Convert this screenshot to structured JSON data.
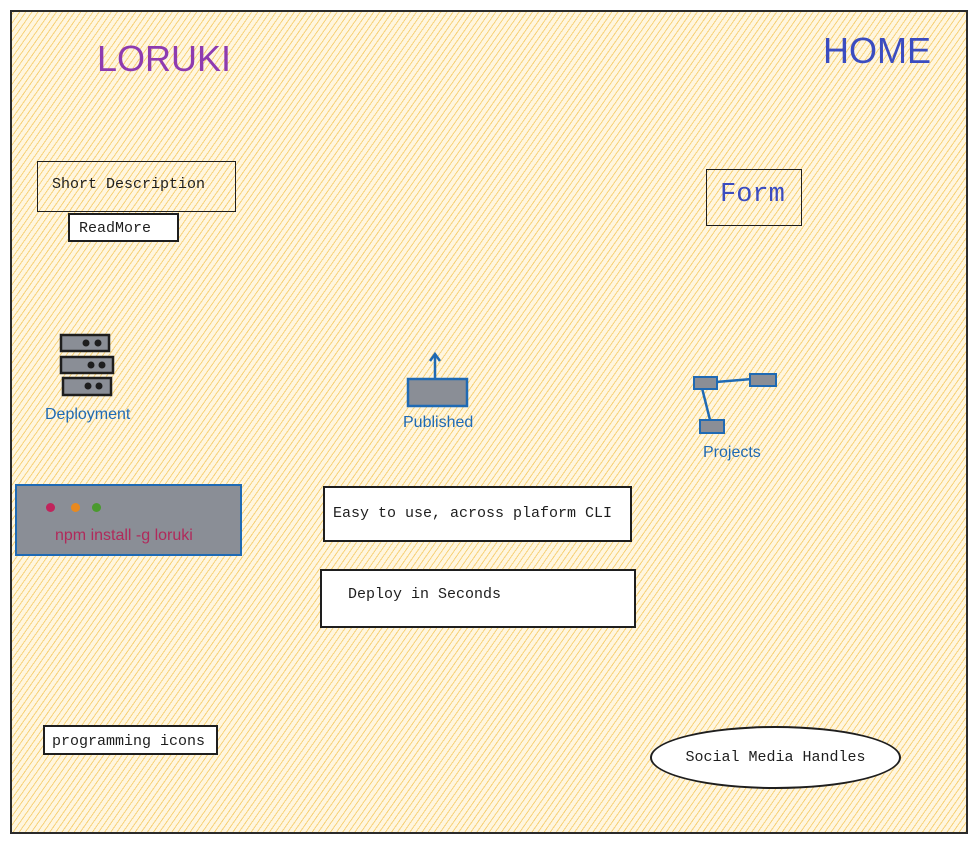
{
  "header": {
    "logo": "LORUKI",
    "nav_home": "HOME"
  },
  "hero": {
    "short_description": "Short Description",
    "readmore_label": "ReadMore",
    "form_label": "Form"
  },
  "features": [
    {
      "label": "Deployment",
      "icon": "server-stack-icon"
    },
    {
      "label": "Published",
      "icon": "upload-icon"
    },
    {
      "label": "Projects",
      "icon": "network-icon"
    }
  ],
  "terminal": {
    "command": "npm install -g loruki",
    "dot_colors": [
      "#c0245c",
      "#e8891e",
      "#4a9a2e"
    ]
  },
  "highlights": [
    "Easy to use, across plaform CLI",
    "Deploy in Seconds"
  ],
  "footer": {
    "programming_icons": "programming icons",
    "social_media": "Social Media Handles"
  },
  "colors": {
    "background": "#fff6df",
    "hatch": "#f0b428",
    "logo": "#8e3bb0",
    "nav": "#3b4cc0",
    "icon_label": "#1f6ab4",
    "terminal_bg": "#8a8e96",
    "terminal_text": "#b02a5b"
  }
}
